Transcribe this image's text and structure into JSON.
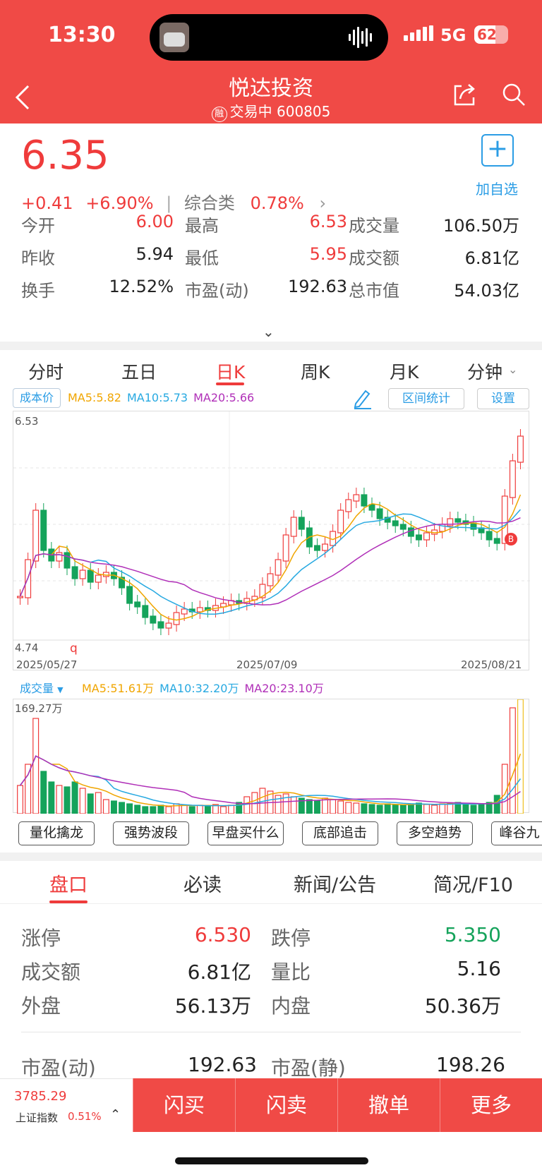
{
  "status_bar": {
    "time": "13:30",
    "network": "5G",
    "battery": "62",
    "battery_level": 0.62
  },
  "header": {
    "title": "悦达投资",
    "badge": "融",
    "subtitle": "交易中 600805"
  },
  "quote": {
    "price": "6.35",
    "change": "+0.41",
    "change_pct": "+6.90%",
    "sector": "综合类",
    "sector_pct": "0.78%"
  },
  "watch": {
    "add_label": "加自选"
  },
  "stats": [
    [
      {
        "label": "今开",
        "value": "6.00",
        "color": "#ef3b3b"
      },
      {
        "label": "最高",
        "value": "6.53",
        "color": "#ef3b3b"
      },
      {
        "label": "成交量",
        "value": "106.50万",
        "color": "#222222"
      }
    ],
    [
      {
        "label": "昨收",
        "value": "5.94",
        "color": "#222222"
      },
      {
        "label": "最低",
        "value": "5.95",
        "color": "#ef3b3b"
      },
      {
        "label": "成交额",
        "value": "6.81亿",
        "color": "#222222"
      }
    ],
    [
      {
        "label": "换手",
        "value": "12.52%",
        "color": "#222222"
      },
      {
        "label": "市盈(动)",
        "value": "192.63",
        "color": "#222222"
      },
      {
        "label": "总市值",
        "value": "54.03亿",
        "color": "#222222"
      }
    ]
  ],
  "period_tabs": [
    "分时",
    "五日",
    "日K",
    "周K",
    "月K",
    "分钟"
  ],
  "chart": {
    "cost_label": "成本价",
    "ma": [
      {
        "label": "MA5:5.82",
        "color": "#f0a500"
      },
      {
        "label": "MA10:5.73",
        "color": "#27a9e1"
      },
      {
        "label": "MA20:5.66",
        "color": "#b02fb8"
      }
    ],
    "range_stat": "区间统计",
    "settings": "设置",
    "y_max": "6.53",
    "y_min": "4.74",
    "x_labels": [
      "2025/05/27",
      "2025/07/09",
      "2025/08/21"
    ],
    "marker_b": "B",
    "marker_q": "q"
  },
  "volume": {
    "label": "成交量",
    "ma": [
      {
        "label": "MA5:51.61万",
        "color": "#f0a500"
      },
      {
        "label": "MA10:32.20万",
        "color": "#27a9e1"
      },
      {
        "label": "MA20:23.10万",
        "color": "#b02fb8"
      }
    ],
    "y_max": "169.27万"
  },
  "strategies": [
    "量化擒龙",
    "强势波段",
    "早盘买什么",
    "底部追击",
    "多空趋势",
    "峰谷九"
  ],
  "section_tabs": [
    "盘口",
    "必读",
    "新闻/公告",
    "简况/F10"
  ],
  "pankou": [
    [
      {
        "label": "涨停",
        "value": "6.530",
        "color": "#ef3b3b"
      },
      {
        "label": "跌停",
        "value": "5.350",
        "color": "#15a35b"
      }
    ],
    [
      {
        "label": "成交额",
        "value": "6.81亿",
        "color": "#222222"
      },
      {
        "label": "量比",
        "value": "5.16",
        "color": "#222222"
      }
    ],
    [
      {
        "label": "外盘",
        "value": "56.13万",
        "color": "#222222"
      },
      {
        "label": "内盘",
        "value": "50.36万",
        "color": "#222222"
      }
    ]
  ],
  "pe_row": [
    {
      "label": "市盈(动)",
      "value": "192.63"
    },
    {
      "label": "市盈(静)",
      "value": "198.26"
    }
  ],
  "index_box": {
    "value": "3785.29",
    "name": "上证指数",
    "pct": "0.51%"
  },
  "trade_buttons": [
    "闪买",
    "闪卖",
    "撤单",
    "更多"
  ],
  "colors": {
    "brand_red": "#f04a46",
    "up": "#ef3b3b",
    "down": "#15a35b",
    "link": "#2b9de5"
  }
}
